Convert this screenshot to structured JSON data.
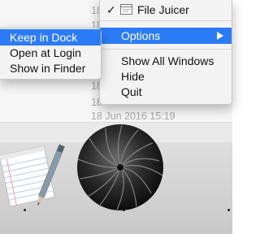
{
  "finder_list": {
    "dates": [
      "18",
      "18",
      "18",
      "18",
      "18",
      "18",
      "18",
      "18 Jun 2016 15:19"
    ]
  },
  "main_menu": {
    "app_item": {
      "label": "File Juicer",
      "checked": true
    },
    "options_label": "Options",
    "show_all_windows_label": "Show All Windows",
    "hide_label": "Hide",
    "quit_label": "Quit"
  },
  "sub_menu": {
    "keep_in_dock_label": "Keep in Dock",
    "open_at_login_label": "Open at Login",
    "show_in_finder_label": "Show in Finder"
  },
  "colors": {
    "highlight": "#2c7bf6",
    "menu_background": "#f3f3f3",
    "dock_background": "#d2d2d2"
  },
  "icons": [
    "check-mark-icon",
    "window-icon",
    "chevron-right-icon",
    "notepad-icon",
    "file-juicer-app-icon"
  ]
}
